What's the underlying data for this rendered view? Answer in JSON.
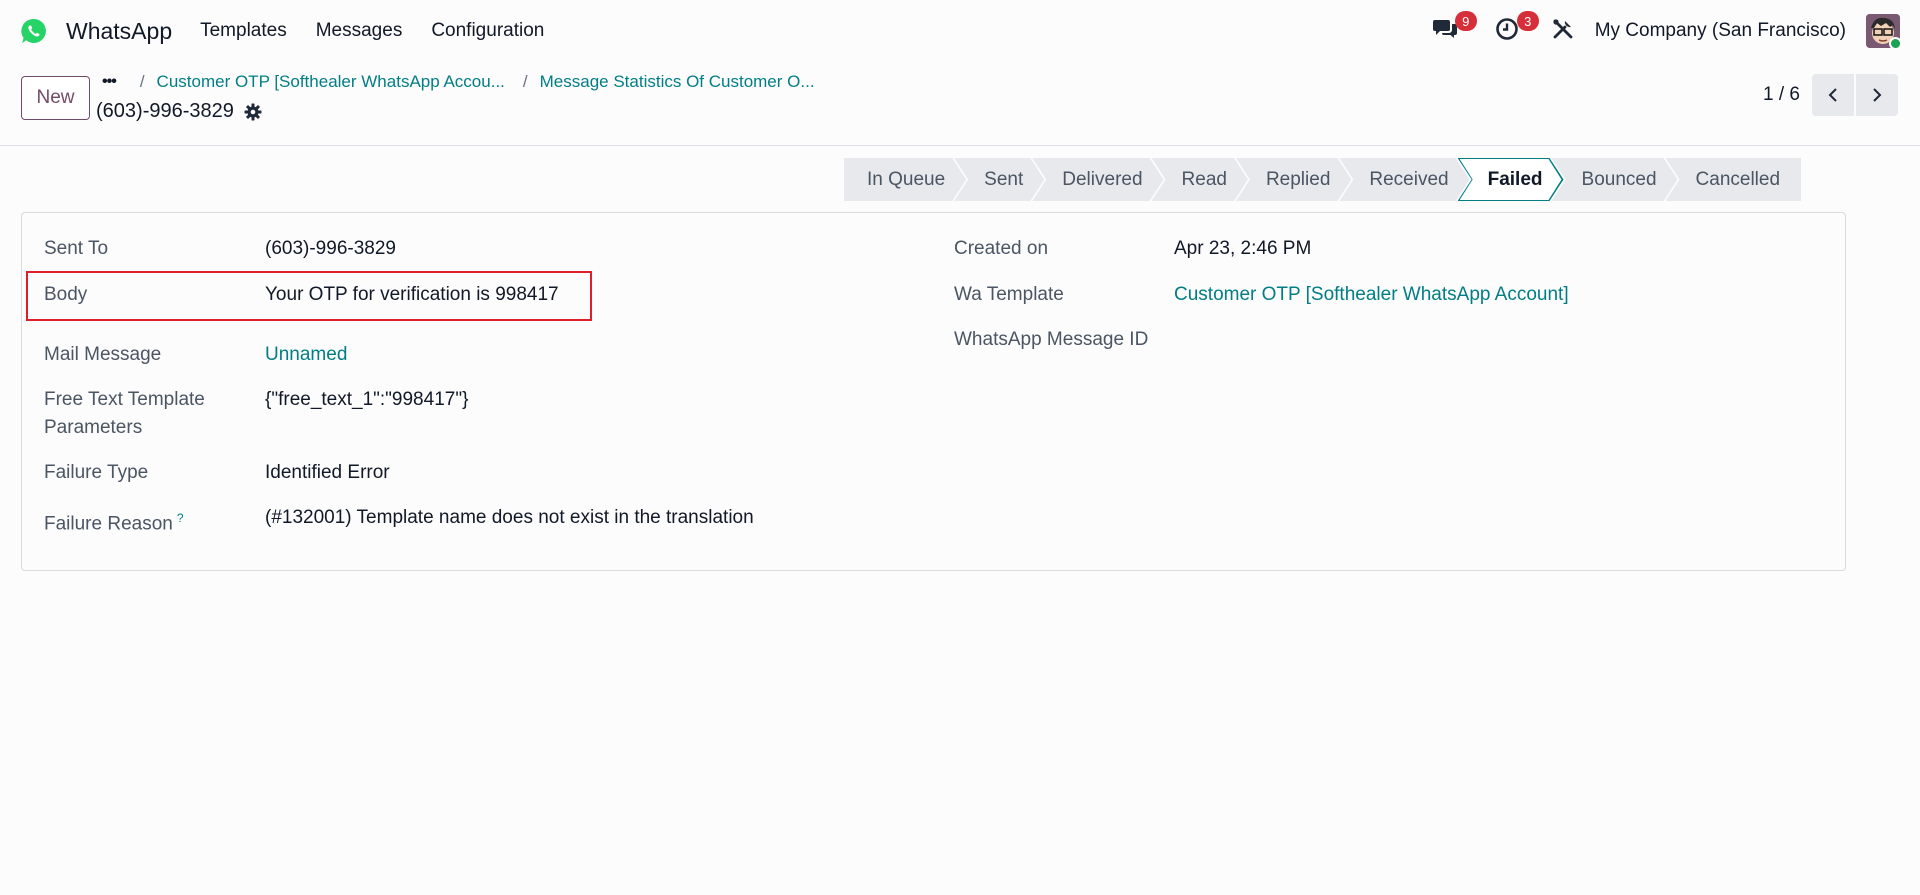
{
  "navbar": {
    "app_name": "WhatsApp",
    "menu": [
      "Templates",
      "Messages",
      "Configuration"
    ],
    "messages_badge": "9",
    "activities_badge": "3",
    "company": "My Company (San Francisco)",
    "icons": {
      "logo": "whatsapp-logo",
      "messages": "chat-bubbles-icon",
      "activities": "clock-icon",
      "debug": "tools-icon"
    },
    "colors": {
      "whatsapp_green": "#25d366",
      "badge_red": "#d62f3a"
    }
  },
  "control_panel": {
    "new_button": "New",
    "breadcrumb": {
      "more": "•••",
      "separator": "/",
      "items": [
        "Customer OTP [Softhealer WhatsApp Accou...",
        "Message Statistics Of Customer O..."
      ]
    },
    "record_title": "(603)-996-3829",
    "pager": {
      "value": "1 / 6"
    }
  },
  "statusbar": {
    "stages": [
      "In Queue",
      "Sent",
      "Delivered",
      "Read",
      "Replied",
      "Received",
      "Failed",
      "Bounced",
      "Cancelled"
    ],
    "active": "Failed",
    "active_color": "#017e84"
  },
  "form": {
    "left": [
      {
        "label": "Sent To",
        "value": "(603)-996-3829"
      },
      {
        "label": "Body",
        "value": "Your OTP for verification is 998417"
      },
      {
        "label": "Mail Message",
        "value": "Unnamed"
      },
      {
        "label": "Free Text Template Parameters",
        "label_line1": "Free Text Template",
        "label_line2": "Parameters",
        "value": "{\"free_text_1\":\"998417\"}"
      },
      {
        "label": "Failure Type",
        "value": "Identified Error"
      },
      {
        "label": "Failure Reason",
        "help": "?",
        "value": "(#132001) Template name does not exist in the translation"
      }
    ],
    "right": [
      {
        "label": "Created on",
        "value": "Apr 23, 2:46 PM"
      },
      {
        "label": "Wa Template",
        "value": "Customer OTP [Softhealer WhatsApp Account]"
      },
      {
        "label": "WhatsApp Message ID",
        "value": ""
      }
    ],
    "link_color": "#017e84",
    "highlight_color": "#e11d2a"
  }
}
